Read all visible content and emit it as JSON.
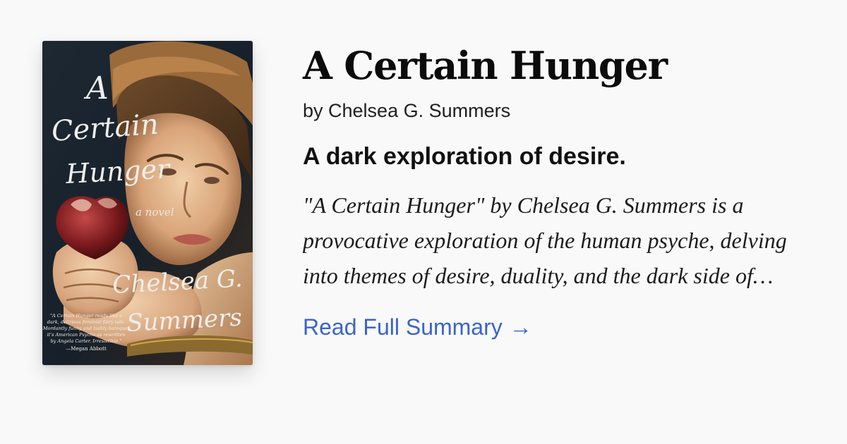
{
  "book": {
    "title": "A Certain Hunger",
    "author_line": "by Chelsea G. Summers",
    "tagline": "A dark exploration of desire.",
    "summary": "\"A Certain Hunger\" by Chelsea G. Summers is a provocative exploration of the human psyche, delving into themes of desire, duality, and the dark side of appetite.",
    "read_more_label": "Read Full Summary",
    "read_more_arrow": "→"
  },
  "cover": {
    "title_line1": "A",
    "title_line2": "Certain",
    "title_line3": "Hunger",
    "subtitle": "a novel",
    "author_line1": "Chelsea G.",
    "author_line2": "Summers",
    "blurb_lines": [
      "\"A Certain Hunger reads like a",
      "dark, delirious feminist fairy tale.",
      "Mordantly funny and lushly baroque,",
      "it's American Psycho as rewritten",
      "by Angela Carter. Irresistible.\""
    ],
    "blurb_credit": "—Megan Abbott"
  },
  "colors": {
    "background": "#f9f9f9",
    "title": "#0b0b0b",
    "link": "#3a64c8"
  }
}
